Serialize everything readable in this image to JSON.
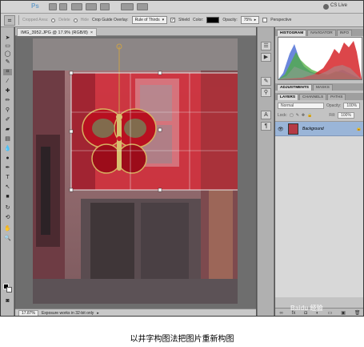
{
  "menubar": {
    "app_logo": "Ps",
    "cs_live": "CS Live"
  },
  "options": {
    "tool_icon": "crop-icon",
    "cropped_area_label": "Cropped Area:",
    "delete_label": "Delete",
    "hide_label": "Hide",
    "overlay_label": "Crop Guide Overlay:",
    "overlay_value": "Rule of Thirds",
    "shield_label": "Shield",
    "color_label": "Color:",
    "opacity_label": "Opacity:",
    "opacity_value": "75%",
    "perspective_label": "Perspective"
  },
  "document": {
    "tab_title": "IMG_3952.JPG @ 17.9% (RGB/8)",
    "zoom": "17.87%",
    "status_text": "Exposure works in 32-bit only"
  },
  "panels": {
    "top_tabs": [
      "HISTOGRAM",
      "NAVIGATOR",
      "INFO"
    ],
    "mid_tabs": [
      "ADJUSTMENTS",
      "MASKS"
    ],
    "layer_tabs": [
      "LAYERS",
      "CHANNELS",
      "PATHS"
    ],
    "blend_mode": "Normal",
    "opacity_label": "Opacity:",
    "opacity_value": "100%",
    "lock_label": "Lock:",
    "fill_label": "Fill:",
    "fill_value": "100%",
    "layer_name": "Background"
  },
  "caption": "以井字构图法把图片重新构图",
  "watermark": "Baidu 经验"
}
